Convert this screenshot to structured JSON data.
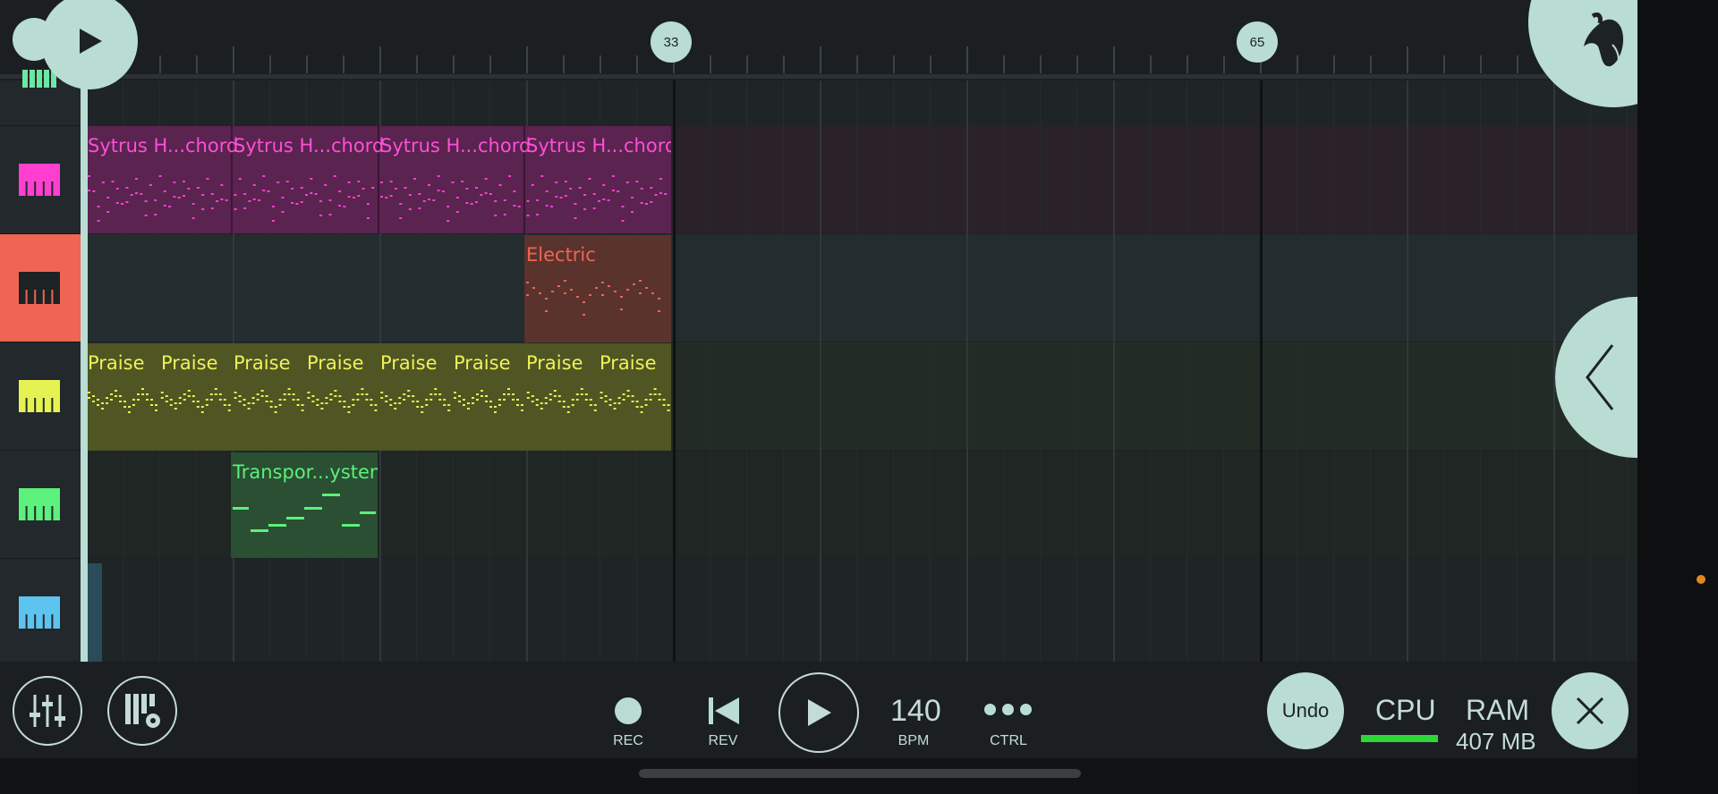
{
  "timeline": {
    "markers": [
      "33",
      "65"
    ]
  },
  "clips": {
    "sytrus": [
      "Sytrus H...chord",
      "Sytrus H...chord",
      "Sytrus H...chord",
      "Sytrus H...chord"
    ],
    "electric": "Electric",
    "praise": [
      "Praise",
      "Praise",
      "Praise",
      "Praise",
      "Praise",
      "Praise",
      "Praise",
      "Praise"
    ],
    "transport": "Transpor...ystem"
  },
  "tracks": [
    {
      "color": "#6ee6a4",
      "icon": "piano-icon"
    },
    {
      "color": "#ff3fd0",
      "icon": "piano-icon"
    },
    {
      "color": "#ef6553",
      "icon": "piano-icon"
    },
    {
      "color": "#e6f252",
      "icon": "piano-icon"
    },
    {
      "color": "#5cf07c",
      "icon": "piano-icon"
    },
    {
      "color": "#5cc4ef",
      "icon": "piano-icon"
    }
  ],
  "transport": {
    "rec_label": "REC",
    "rev_label": "REV",
    "bpm_value": "140",
    "bpm_label": "BPM",
    "ctrl_label": "CTRL",
    "undo_label": "Undo",
    "cpu_label": "CPU",
    "ram_label": "RAM",
    "ram_value": "407 MB"
  },
  "colors": {
    "accent": "#b9ddd3",
    "cpu_meter": "#2fd63a"
  }
}
